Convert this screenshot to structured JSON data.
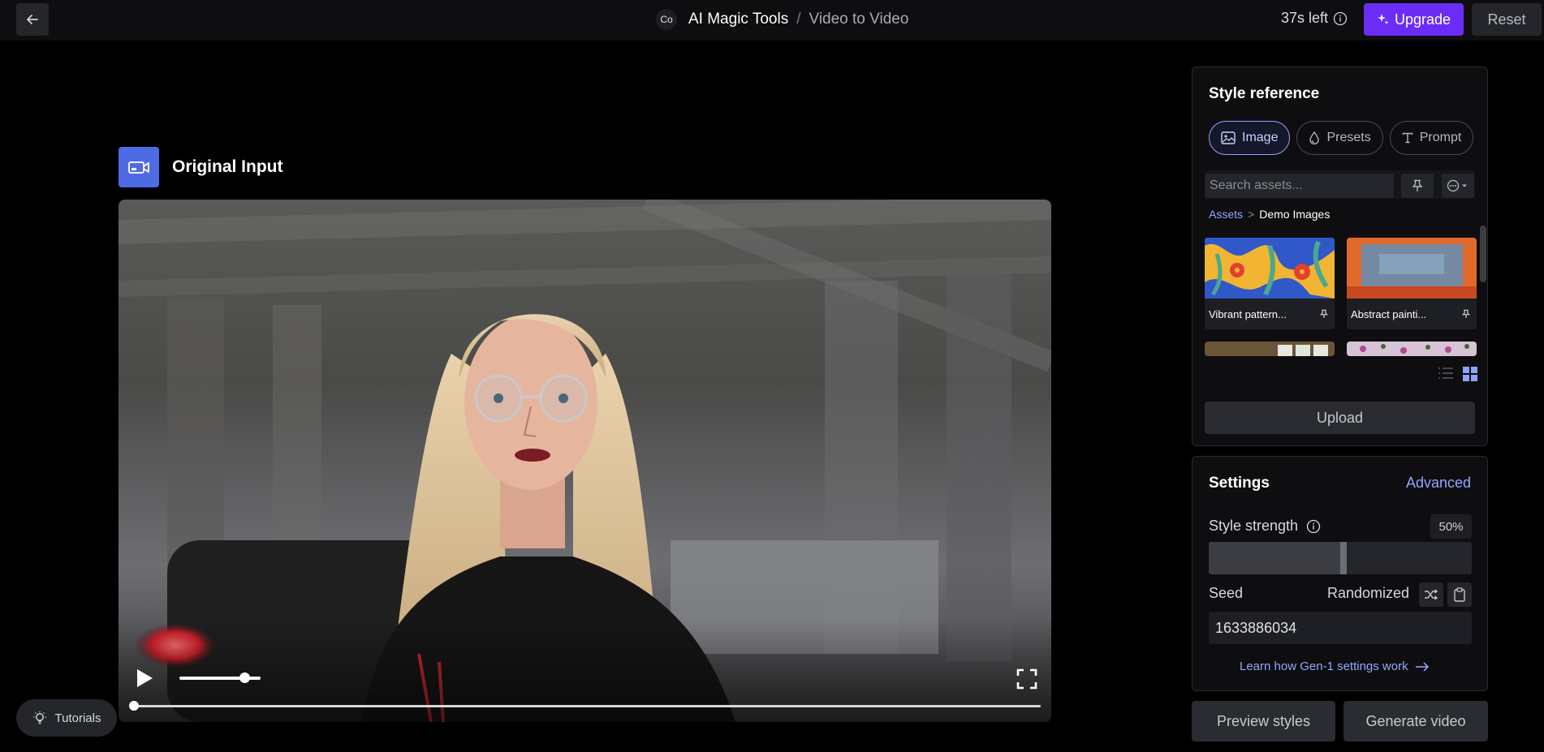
{
  "topbar": {
    "avatar_initials": "Co",
    "app_name": "AI Magic Tools",
    "separator": "/",
    "page_name": "Video to Video",
    "time_left": "37s left",
    "upgrade_label": "Upgrade",
    "reset_label": "Reset"
  },
  "main": {
    "input_title": "Original Input",
    "video": {
      "volume_fraction": 0.8,
      "progress_fraction": 0.0
    }
  },
  "tutorials_label": "Tutorials",
  "style_reference": {
    "title": "Style reference",
    "tabs": [
      {
        "label": "Image",
        "icon": "image-icon",
        "active": true
      },
      {
        "label": "Presets",
        "icon": "drop-icon",
        "active": false
      },
      {
        "label": "Prompt",
        "icon": "text-icon",
        "active": false
      }
    ],
    "search_placeholder": "Search assets...",
    "breadcrumb": {
      "root": "Assets",
      "separator": ">",
      "current": "Demo Images"
    },
    "assets": [
      {
        "name": "Vibrant pattern..."
      },
      {
        "name": "Abstract painti..."
      }
    ],
    "upload_label": "Upload"
  },
  "settings": {
    "title": "Settings",
    "advanced_label": "Advanced",
    "style_strength_label": "Style strength",
    "style_strength_value": "50%",
    "style_strength_fraction": 0.5,
    "seed_label": "Seed",
    "randomized_label": "Randomized",
    "seed_value": "1633886034",
    "learn_link": "Learn how Gen-1 settings work"
  },
  "actions": {
    "preview_label": "Preview styles",
    "generate_label": "Generate video"
  },
  "colors": {
    "accent_purple": "#6b2df5",
    "link_blue": "#94a6ff",
    "input_icon_blue": "#4f6be3"
  }
}
